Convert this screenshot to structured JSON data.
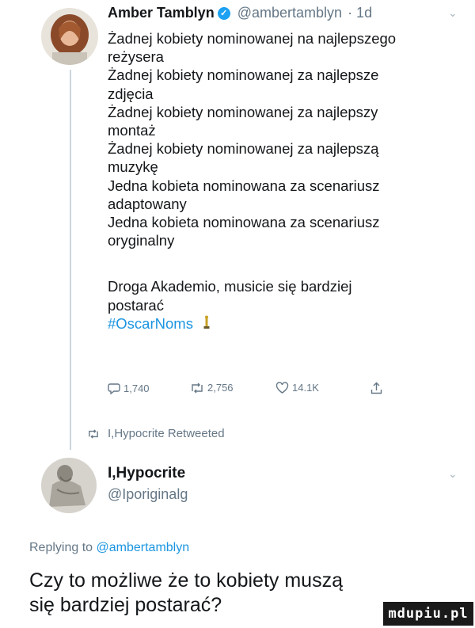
{
  "tweet": {
    "author_name": "Amber Tamblyn",
    "author_handle": "@ambertamblyn",
    "time": "· 1d",
    "lines": [
      "Żadnej kobiety nominowanej na najlepszego",
      "reżysera",
      "Żadnej kobiety nominowanej za najlepsze",
      "zdjęcia",
      "Żadnej kobiety nominowanej za najlepszy",
      "montaż",
      "Żadnej kobiety nominowanej za najlepszą",
      "muzykę",
      "Jedna kobieta nominowana za scenariusz",
      "adaptowany",
      "Jedna kobieta nominowana za scenariusz",
      "oryginalny"
    ],
    "closing_lines": [
      "Droga Akademio, musicie się bardziej",
      "postarać"
    ],
    "hashtag": "#OscarNoms",
    "reply_count": "1,740",
    "retweet_count": "2,756",
    "like_count": "14.1K"
  },
  "retweeted_by": "I,Hypocrite Retweeted",
  "quoted_tweet": {
    "author_name": "I,Hypocrite",
    "author_handle": "@Iporiginalg",
    "replying_prefix": "Replying to",
    "replying_to": "@ambertamblyn",
    "text_lines": [
      "Czy to możliwe że to kobiety muszą",
      "się bardziej postarać?"
    ]
  },
  "watermark": "mdupiu.pl",
  "colors": {
    "text": "#14171a",
    "secondary": "#657786",
    "link": "#1b95e0",
    "verified": "#1da1f2"
  }
}
